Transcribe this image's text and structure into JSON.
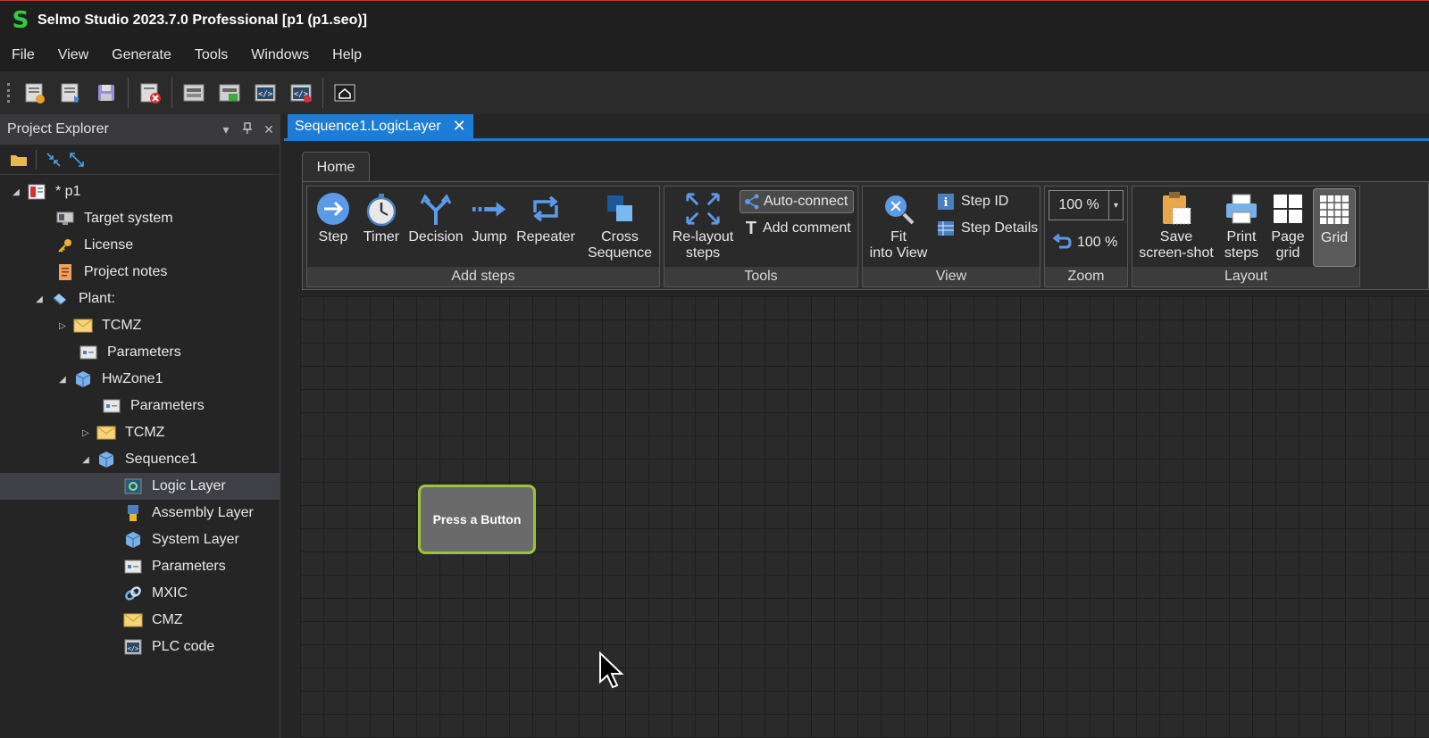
{
  "window": {
    "logo": "S",
    "title": "Selmo Studio 2023.7.0 Professional  [p1 (p1.seo)]"
  },
  "menu": [
    "File",
    "View",
    "Generate",
    "Tools",
    "Windows",
    "Help"
  ],
  "toolbar_icons": [
    "new-project-icon",
    "open-project-icon",
    "save-icon",
    "close-project-icon",
    "layout-icon",
    "export-icon",
    "code-icon",
    "code-stop-icon",
    "home-icon"
  ],
  "explorer": {
    "title": "Project Explorer",
    "tree": [
      {
        "label": "* p1",
        "level": 0,
        "toggle": "expanded",
        "icon": "project-icon"
      },
      {
        "label": "Target system",
        "level": 1,
        "toggle": "none",
        "icon": "target-system-icon"
      },
      {
        "label": "License",
        "level": 1,
        "toggle": "none",
        "icon": "key-icon"
      },
      {
        "label": "Project notes",
        "level": 1,
        "toggle": "none",
        "icon": "notes-icon"
      },
      {
        "label": "Plant:",
        "level": 1,
        "toggle": "expanded",
        "icon": "plant-icon"
      },
      {
        "label": "TCMZ",
        "level": 2,
        "toggle": "collapsed",
        "icon": "envelope-icon"
      },
      {
        "label": "Parameters",
        "level": 2,
        "toggle": "none",
        "icon": "parameters-icon"
      },
      {
        "label": "HwZone1",
        "level": 2,
        "toggle": "expanded",
        "icon": "cube-icon"
      },
      {
        "label": "Parameters",
        "level": 3,
        "toggle": "none",
        "icon": "parameters-icon"
      },
      {
        "label": "TCMZ",
        "level": 3,
        "toggle": "collapsed",
        "icon": "envelope-icon"
      },
      {
        "label": "Sequence1",
        "level": 3,
        "toggle": "expanded",
        "icon": "cube-icon"
      },
      {
        "label": "Logic Layer",
        "level": 4,
        "toggle": "none",
        "icon": "logic-layer-icon",
        "selected": true
      },
      {
        "label": "Assembly Layer",
        "level": 4,
        "toggle": "none",
        "icon": "assembly-layer-icon"
      },
      {
        "label": "System Layer",
        "level": 4,
        "toggle": "none",
        "icon": "cube-icon"
      },
      {
        "label": "Parameters",
        "level": 4,
        "toggle": "none",
        "icon": "parameters-icon"
      },
      {
        "label": "MXIC",
        "level": 4,
        "toggle": "none",
        "icon": "link-icon"
      },
      {
        "label": "CMZ",
        "level": 4,
        "toggle": "none",
        "icon": "envelope-icon"
      },
      {
        "label": "PLC code",
        "level": 4,
        "toggle": "none",
        "icon": "code-icon"
      }
    ]
  },
  "document_tab": {
    "label": "Sequence1.LogicLayer"
  },
  "ribbon": {
    "tab": "Home",
    "groups": {
      "add_steps": {
        "label": "Add steps",
        "step": "Step",
        "timer": "Timer",
        "decision": "Decision",
        "jump": "Jump",
        "repeater": "Repeater",
        "cross_1": "Cross",
        "cross_2": "Sequence"
      },
      "tools": {
        "label": "Tools",
        "relayout_1": "Re-layout",
        "relayout_2": "steps",
        "auto_connect": "Auto-connect",
        "add_comment": "Add comment"
      },
      "view": {
        "label": "View",
        "fit_1": "Fit",
        "fit_2": "into View",
        "step_id": "Step ID",
        "step_details": "Step Details"
      },
      "zoom": {
        "label": "Zoom",
        "value": "100 %",
        "reset": "100 %"
      },
      "layout": {
        "label": "Layout",
        "save_1": "Save",
        "save_2": "screen-shot",
        "print_1": "Print",
        "print_2": "steps",
        "page_1": "Page",
        "page_2": "grid",
        "grid": "Grid"
      }
    }
  },
  "canvas": {
    "step_node": "Press a Button"
  }
}
